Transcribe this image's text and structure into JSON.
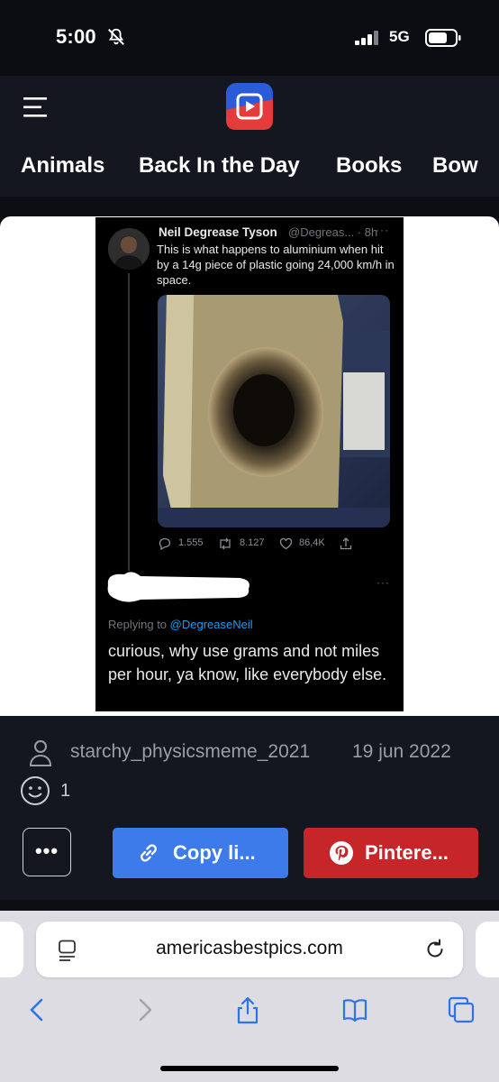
{
  "status_bar": {
    "time": "5:00",
    "network": "5G"
  },
  "header": {
    "categories": [
      "Animals",
      "Back In the Day",
      "Books",
      "Bow"
    ]
  },
  "post": {
    "tweet": {
      "author": "Neil Degrease Tyson",
      "handle_time": "@Degreas... · 8h",
      "text": "This is what happens to aluminium when hit by a 14g piece of plastic going 24,000 km/h in space.",
      "replies": "1.555",
      "retweets": "8.127",
      "likes": "86,4K"
    },
    "reply": {
      "replying_prefix": "Replying to ",
      "replying_handle": "@DegreaseNeil",
      "text": "curious, why use grams and not miles per hour, ya know, like everybody else."
    }
  },
  "meta": {
    "author": "starchy_physicsmeme_2021",
    "date": "19 jun 2022",
    "reactions": "1"
  },
  "actions": {
    "more": "•••",
    "copy_label": "Copy li...",
    "pinterest_label": "Pintere..."
  },
  "browser": {
    "url": "americasbestpics.com"
  },
  "colors": {
    "accent_copy": "#3d7bea",
    "accent_pinterest": "#c6262a",
    "twitter_link": "#1d9bf0"
  }
}
